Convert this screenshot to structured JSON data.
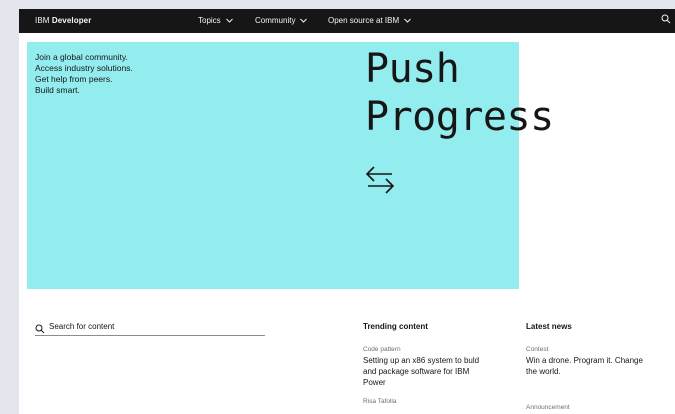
{
  "header": {
    "brand_prefix": "IBM",
    "brand_name": "Developer",
    "nav": [
      {
        "label": "Topics"
      },
      {
        "label": "Community"
      },
      {
        "label": "Open source at IBM"
      }
    ]
  },
  "hero": {
    "tagline": [
      "Join a global community.",
      "Access industry solutions.",
      "Get help from peers.",
      "Build smart."
    ],
    "headline_line1": "Push",
    "headline_line2": "Progress"
  },
  "search": {
    "placeholder": "Search for content"
  },
  "trending": {
    "title": "Trending content",
    "items": [
      {
        "category": "Code pattern",
        "title": "Setting up an x86 system to buld and package software for IBM Power"
      },
      {
        "category": "Risa Tafolla",
        "title": ""
      }
    ]
  },
  "news": {
    "title": "Latest news",
    "items": [
      {
        "category": "Contest",
        "title": "Win a drone. Program it. Change the world."
      },
      {
        "category": "Announcement",
        "title": ""
      }
    ]
  }
}
